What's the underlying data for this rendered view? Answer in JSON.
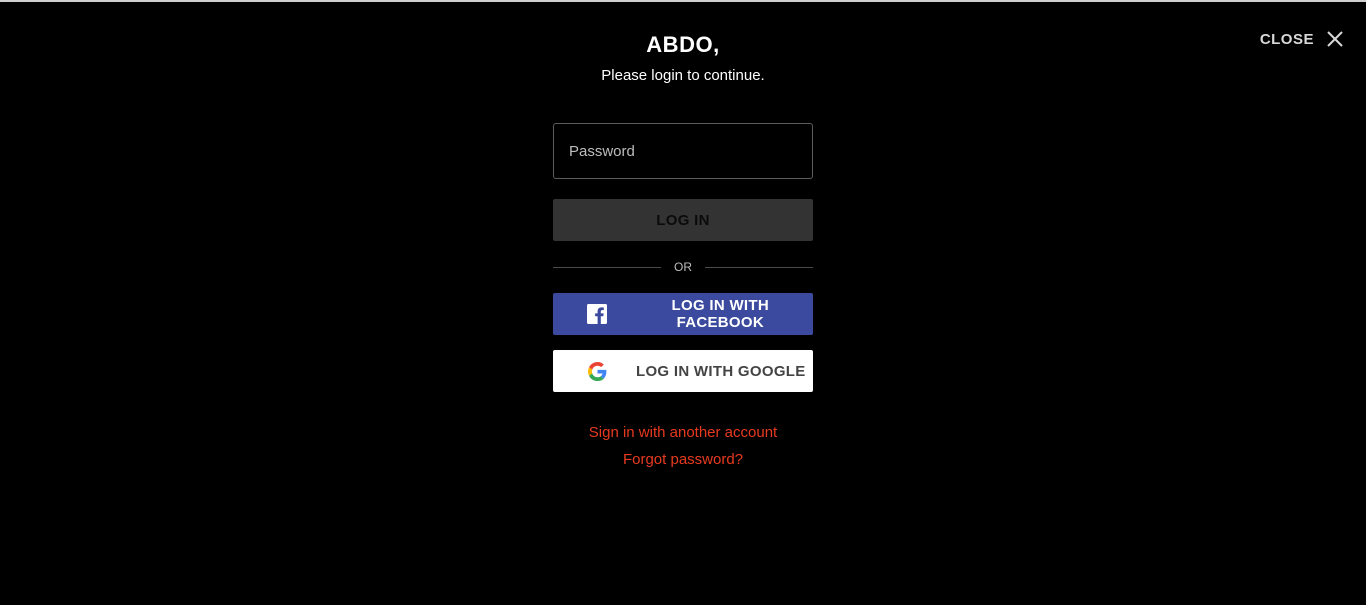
{
  "header": {
    "close_label": "CLOSE"
  },
  "login": {
    "title": "ABDO,",
    "subtitle": "Please login to continue.",
    "password_placeholder": "Password",
    "login_button": "LOG IN",
    "divider_text": "OR",
    "facebook_button": "LOG IN WITH FACEBOOK",
    "google_button": "LOG IN WITH GOOGLE",
    "other_account_link": "Sign in with another account",
    "forgot_password_link": "Forgot password?"
  },
  "icons": {
    "close": "close-icon",
    "facebook": "facebook-icon",
    "google": "google-icon"
  },
  "colors": {
    "background": "#000000",
    "facebook_blue": "#3b4a9e",
    "link_red": "#e83a1f",
    "login_button_bg": "#333333"
  }
}
